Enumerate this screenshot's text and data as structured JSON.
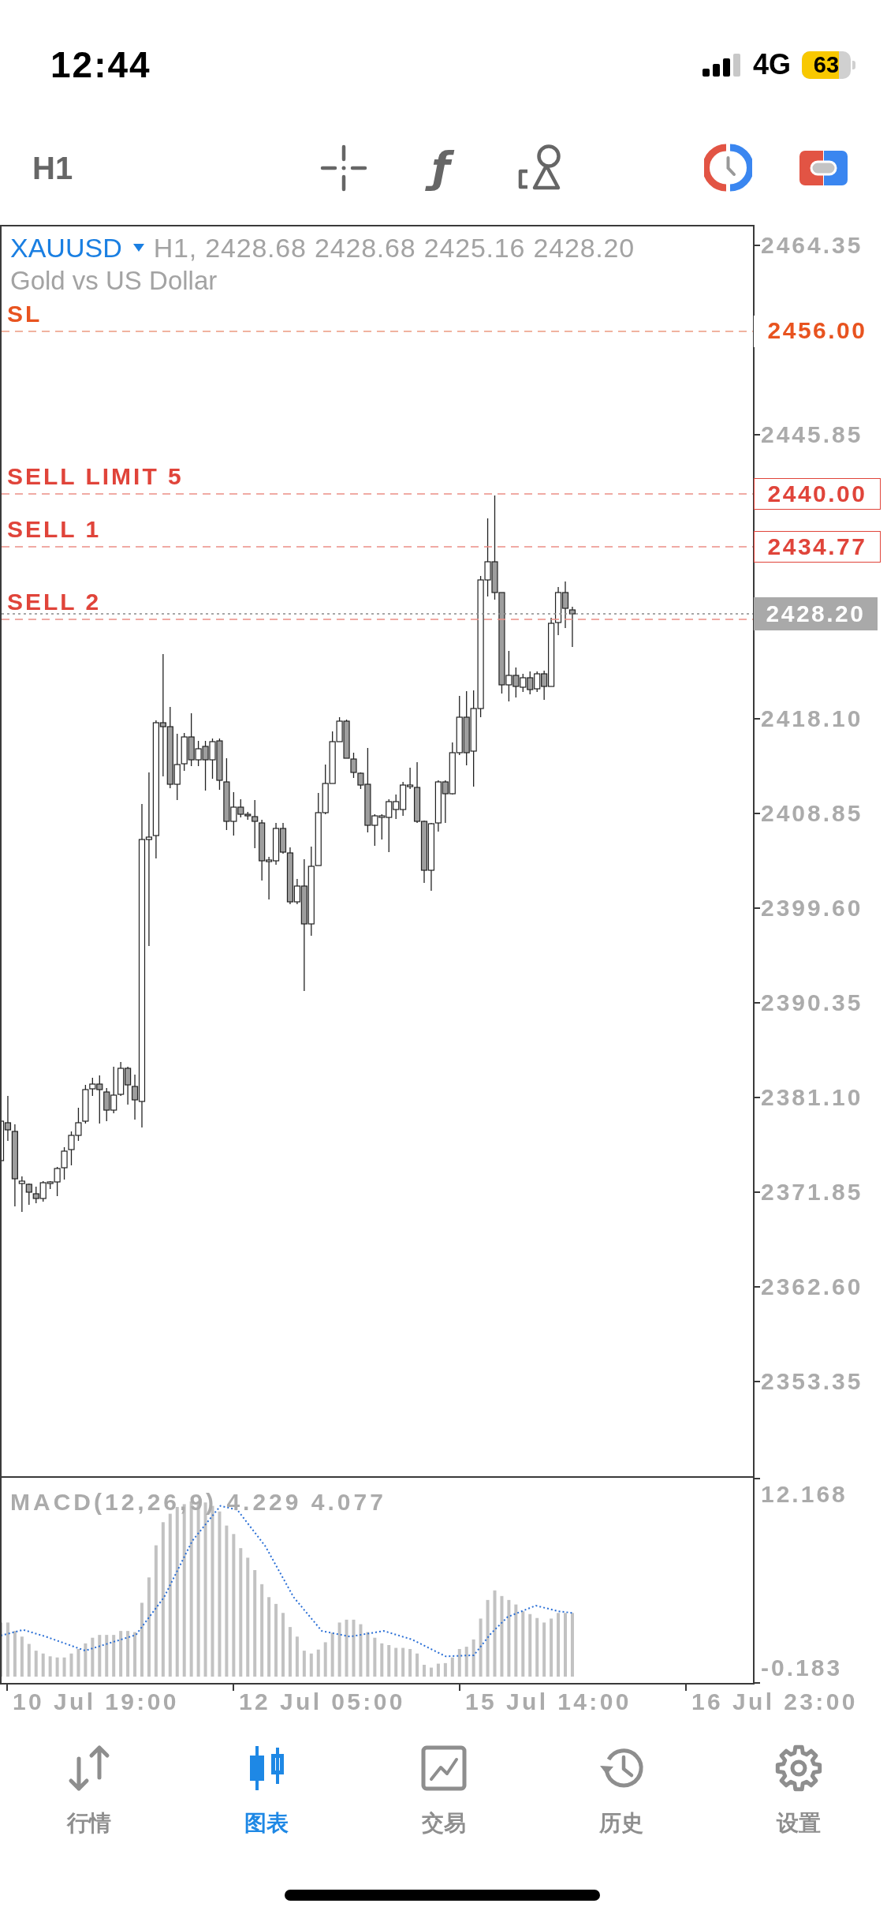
{
  "status_bar": {
    "time": "12:44",
    "network": "4G",
    "battery": "63"
  },
  "toolbar": {
    "timeframe": "H1",
    "indicators_glyph": "ƒ"
  },
  "chart": {
    "symbol": "XAUUSD",
    "ohlc": "H1, 2428.68 2428.68 2425.16 2428.20",
    "description": "Gold vs US Dollar",
    "order_lines": [
      {
        "kind": "stop_loss",
        "label": "SL",
        "price": "2456.00"
      },
      {
        "kind": "order",
        "label": "SELL LIMIT 5",
        "price": "2440.00"
      },
      {
        "kind": "order",
        "label": "SELL 1",
        "price": "2434.77"
      },
      {
        "kind": "order",
        "label": "SELL 2"
      }
    ],
    "bid": "2428.20",
    "price_axis": [
      "2464.35",
      "2445.85",
      "2418.10",
      "2408.85",
      "2399.60",
      "2390.35",
      "2381.10",
      "2371.85",
      "2362.60",
      "2353.35"
    ],
    "indicator": {
      "label": "MACD(12,26,9) 4.229 4.077",
      "scale": [
        "12.168",
        "-0.183"
      ]
    },
    "time_axis": [
      "10 Jul 19:00",
      "12 Jul 05:00",
      "15 Jul 14:00",
      "16 Jul 23:00"
    ]
  },
  "tabs": [
    {
      "label": "行情",
      "selected": false
    },
    {
      "label": "图表",
      "selected": true
    },
    {
      "label": "交易",
      "selected": false
    },
    {
      "label": "历史",
      "selected": false
    },
    {
      "label": "设置",
      "selected": false
    }
  ]
}
